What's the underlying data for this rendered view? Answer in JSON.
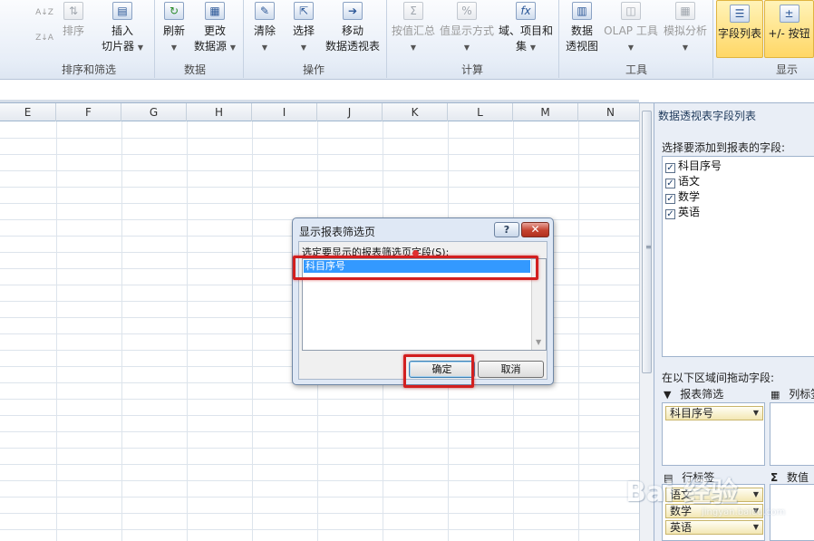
{
  "ribbon": {
    "groups": [
      {
        "label": "排序和筛选"
      },
      {
        "label": "数据"
      },
      {
        "label": "操作"
      },
      {
        "label": "计算"
      },
      {
        "label": "工具"
      },
      {
        "label": "显示"
      }
    ],
    "buttons": {
      "sort_az_icon": "A↓Z",
      "sort_za_icon": "Z↓A",
      "sort": "排序",
      "insert_slicer": "插入",
      "insert_slicer_2": "切片器",
      "refresh": "刷新",
      "change_source": "更改",
      "change_source_2": "数据源",
      "clear": "清除",
      "select": "选择",
      "move_pivot": "移动",
      "move_pivot_2": "数据透视表",
      "summarize_by": "按值汇总",
      "show_values_as": "值显示方式",
      "fields_items": "域、项目和",
      "fields_items_2": "集",
      "pivot_chart": "数据",
      "pivot_chart_2": "透视图",
      "olap_tools": "OLAP 工具",
      "what_if": "模拟分析",
      "field_list": "字段列表",
      "plus_minus": "+/- 按钮"
    }
  },
  "sheet": {
    "columns": [
      "E",
      "F",
      "G",
      "H",
      "I",
      "J",
      "K",
      "L",
      "M",
      "N"
    ]
  },
  "panel": {
    "title": "数据透视表字段列表",
    "choose_label": "选择要添加到报表的字段:",
    "fields": [
      {
        "name": "科目序号",
        "checked": true
      },
      {
        "name": "语文",
        "checked": true
      },
      {
        "name": "数学",
        "checked": true
      },
      {
        "name": "英语",
        "checked": true
      }
    ],
    "drag_label": "在以下区域间拖动字段:",
    "report_filter": "报表筛选",
    "column_labels": "列标签",
    "row_labels": "行标签",
    "values": "数值",
    "filter_items": [
      "科目序号"
    ],
    "row_items": [
      "语文",
      "数学",
      "英语"
    ]
  },
  "dialog": {
    "title": "显示报表筛选页",
    "help": "?",
    "close": "✕",
    "prompt": "选定要显示的报表筛选页字段(S):",
    "items": [
      "科目序号"
    ],
    "ok": "确定",
    "cancel": "取消"
  },
  "watermark": {
    "text": "Bai 经验",
    "sub": "jingyan.baidu.com"
  },
  "colors": {
    "highlight_red": "#d21f1f",
    "selection_blue": "#3399ff",
    "ribbon_active": "#ffd766"
  }
}
